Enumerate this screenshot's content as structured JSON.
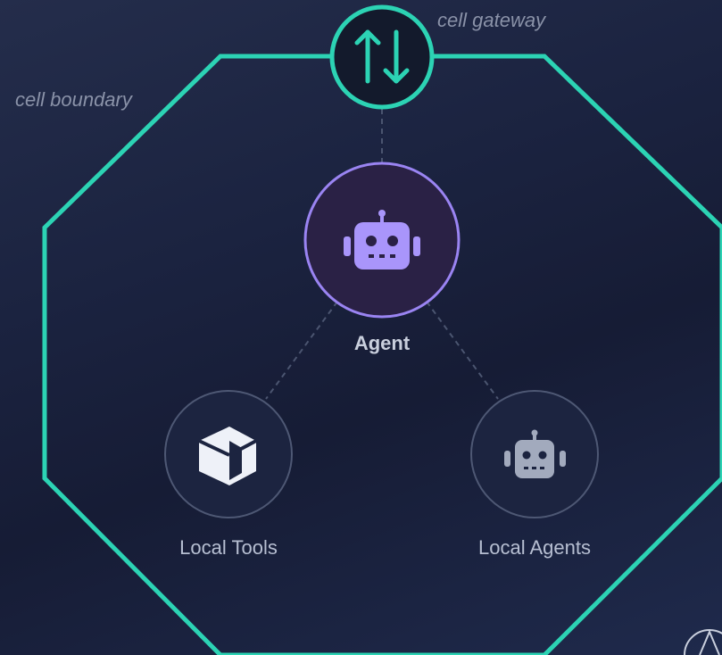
{
  "labels": {
    "cell_gateway": "cell gateway",
    "cell_boundary": "cell boundary"
  },
  "nodes": {
    "agent": {
      "label": "Agent",
      "icon": "robot-icon"
    },
    "local_tools": {
      "label": "Local Tools",
      "icon": "cube-icon"
    },
    "local_agents": {
      "label": "Local Agents",
      "icon": "robot-icon"
    },
    "gateway": {
      "icon": "arrows-up-down-icon"
    }
  },
  "colors": {
    "boundary": "#2cd3b4",
    "agent_accent": "#9a84f2",
    "agent_fill": "#2a2145",
    "node_stroke": "#4e5874",
    "node_fill": "#1c2440",
    "connector": "#4b5570",
    "gateway_fill": "#131a2c"
  }
}
